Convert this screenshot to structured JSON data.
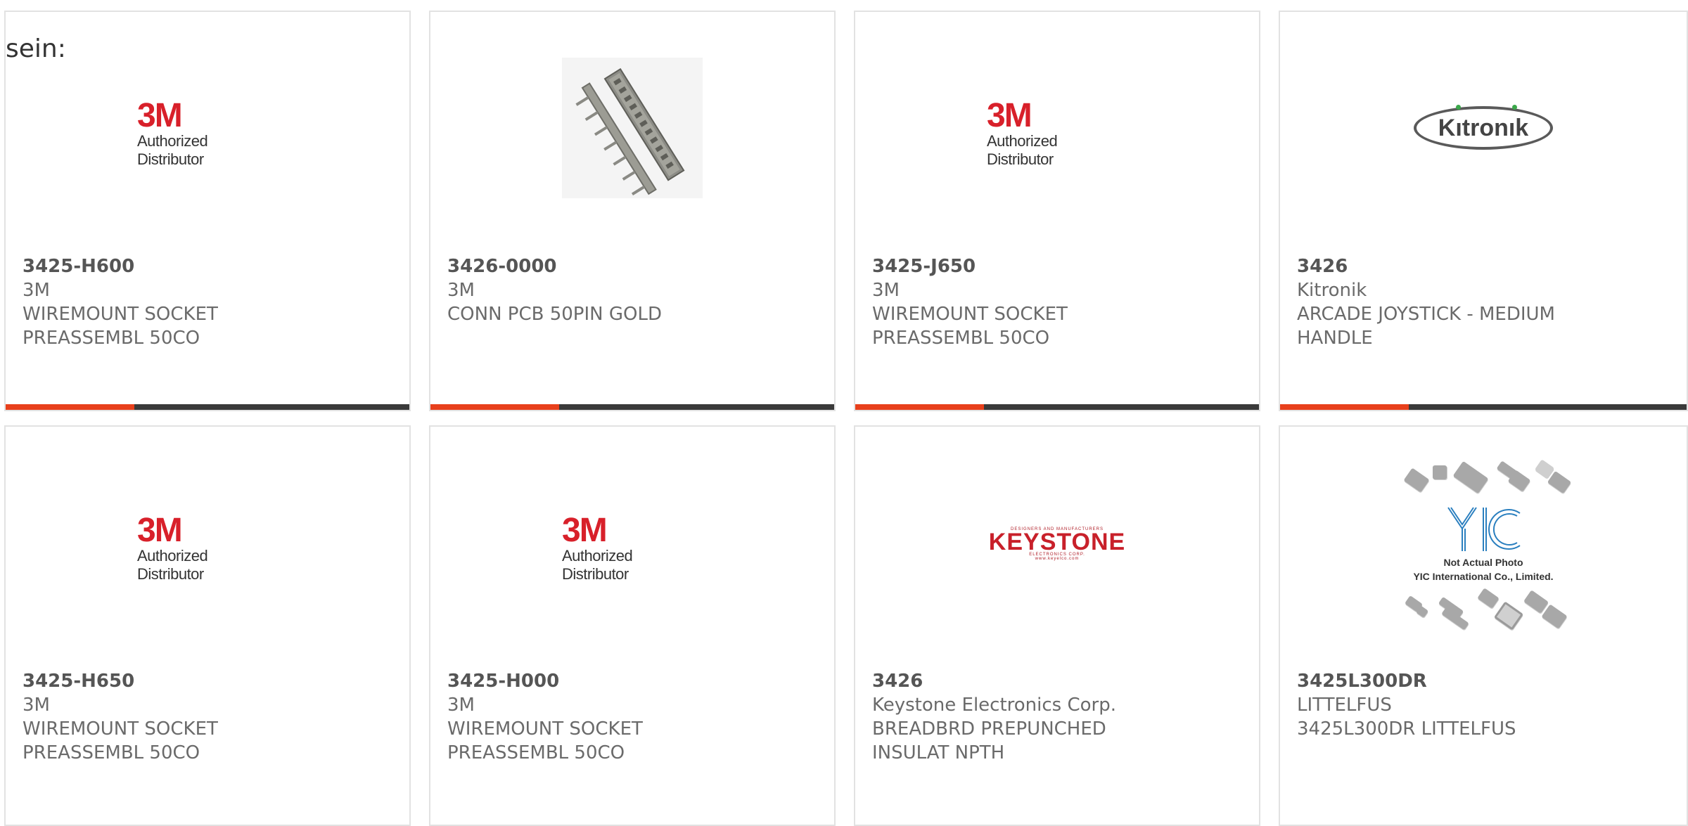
{
  "intro_text": "sein:",
  "colors": {
    "accent": "#e8401c",
    "bar": "#3a3a3a",
    "border": "#e2e2e2",
    "brand_3m": "#d8202a"
  },
  "products": [
    {
      "part_number": "3425-H600",
      "manufacturer": "3M",
      "description_line1": "WIREMOUNT SOCKET",
      "description_line2": "PREASSEMBL 50CO",
      "image": "3m-authorized-distributor-logo",
      "logo_mark": "3M",
      "logo_sub": "Authorized Distributor"
    },
    {
      "part_number": "3426-0000",
      "manufacturer": "3M",
      "description_line1": "CONN PCB 50PIN GOLD",
      "description_line2": "",
      "image": "pcb-connector-photo"
    },
    {
      "part_number": "3425-J650",
      "manufacturer": "3M",
      "description_line1": "WIREMOUNT SOCKET",
      "description_line2": "PREASSEMBL 50CO",
      "image": "3m-authorized-distributor-logo",
      "logo_mark": "3M",
      "logo_sub": "Authorized Distributor"
    },
    {
      "part_number": "3426",
      "manufacturer": "Kitronik",
      "description_line1": "ARCADE JOYSTICK - MEDIUM",
      "description_line2": "HANDLE",
      "image": "kitronik-logo",
      "logo_mark": "Kıtronık"
    },
    {
      "part_number": "3425-H650",
      "manufacturer": "3M",
      "description_line1": "WIREMOUNT SOCKET",
      "description_line2": "PREASSEMBL 50CO",
      "image": "3m-authorized-distributor-logo",
      "logo_mark": "3M",
      "logo_sub": "Authorized Distributor"
    },
    {
      "part_number": "3425-H000",
      "manufacturer": "3M",
      "description_line1": "WIREMOUNT SOCKET",
      "description_line2": "PREASSEMBL 50CO",
      "image": "3m-authorized-distributor-logo",
      "logo_mark": "3M",
      "logo_sub": "Authorized Distributor"
    },
    {
      "part_number": "3426",
      "manufacturer": "Keystone Electronics Corp.",
      "description_line1": "BREADBRD PREPUNCHED",
      "description_line2": "INSULAT NPTH",
      "image": "keystone-logo",
      "logo_top": "DESIGNERS AND MANUFACTURERS",
      "logo_mark": "KEYSTONE",
      "logo_mid": "ELECTRONICS CORP.",
      "logo_bot": "www.keyelco.com"
    },
    {
      "part_number": "3425L300DR",
      "manufacturer": "LITTELFUS",
      "description_line1": "3425L300DR LITTELFUS",
      "description_line2": "",
      "image": "yic-not-actual-photo",
      "logo_note1": "Not Actual Photo",
      "logo_note2": "YIC International Co., Limited."
    }
  ]
}
